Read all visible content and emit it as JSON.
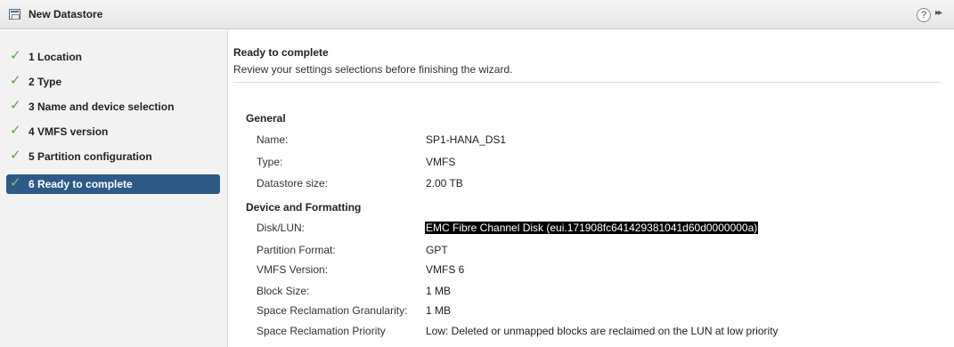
{
  "window": {
    "title": "New Datastore"
  },
  "steps": [
    {
      "label": "1  Location"
    },
    {
      "label": "2  Type"
    },
    {
      "label": "3  Name and device selection"
    },
    {
      "label": "4  VMFS version"
    },
    {
      "label": "5  Partition configuration"
    },
    {
      "label": "6  Ready to complete"
    }
  ],
  "page": {
    "heading": "Ready to complete",
    "subheading": "Review your settings selections before finishing the wizard."
  },
  "general": {
    "title": "General",
    "rows": [
      {
        "label": "Name:",
        "value": "SP1-HANA_DS1"
      },
      {
        "label": "Type:",
        "value": "VMFS"
      },
      {
        "label": "Datastore size:",
        "value": "2.00 TB"
      }
    ]
  },
  "formatting": {
    "title": "Device and Formatting",
    "rows": [
      {
        "label": "Disk/LUN:",
        "value": "EMC Fibre Channel Disk (eui.171908fc641429381041d60d0000000a)"
      },
      {
        "label": "Partition Format:",
        "value": "GPT"
      },
      {
        "label": "VMFS Version:",
        "value": "VMFS 6"
      },
      {
        "label": "Block Size:",
        "value": "1 MB"
      },
      {
        "label": "Space Reclamation Granularity:",
        "value": "1 MB"
      },
      {
        "label": "Space Reclamation Priority",
        "value": "Low: Deleted or unmapped blocks are reclaimed on the LUN at low priority"
      }
    ]
  },
  "icons": {
    "help": "?",
    "expand": "▸▸"
  },
  "colors": {
    "active_step": "#2d5a86",
    "check": "#57a53f",
    "selection": "#000000"
  }
}
